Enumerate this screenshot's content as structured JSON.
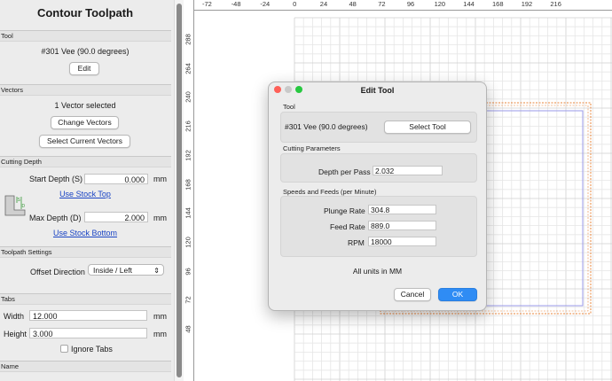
{
  "panel": {
    "title": "Contour Toolpath",
    "tool_section": {
      "header": "Tool",
      "tool_name": "#301 Vee (90.0 degrees)",
      "edit_label": "Edit"
    },
    "vectors_section": {
      "header": "Vectors",
      "status": "1 Vector selected",
      "change_label": "Change Vectors",
      "select_current_label": "Select Current Vectors"
    },
    "depth_section": {
      "header": "Cutting Depth",
      "start_label": "Start Depth (S)",
      "start_value": "0.000",
      "use_stock_top": "Use Stock Top",
      "max_label": "Max Depth (D)",
      "max_value": "2.000",
      "use_stock_bottom": "Use Stock Bottom",
      "unit": "mm",
      "diagram_s": "S",
      "diagram_d": "D"
    },
    "settings_section": {
      "header": "Toolpath Settings",
      "offset_label": "Offset Direction",
      "offset_value": "Inside / Left",
      "offset_icon": "chevron-updown-icon"
    },
    "tabs_section": {
      "header": "Tabs",
      "width_label": "Width",
      "width_value": "12.000",
      "height_label": "Height",
      "height_value": "3.000",
      "unit": "mm",
      "ignore_label": "Ignore Tabs",
      "ignore_checked": false
    },
    "name_section": {
      "header": "Name"
    }
  },
  "canvas": {
    "h_ticks": [
      "-72",
      "-48",
      "-24",
      "0",
      "24",
      "48",
      "72",
      "96",
      "120",
      "144",
      "168",
      "192",
      "216"
    ],
    "v_ticks": [
      "288",
      "264",
      "240",
      "216",
      "192",
      "168",
      "144",
      "120",
      "96",
      "72",
      "48"
    ],
    "colors": {
      "grid_minor": "#e6e6e6",
      "grid_major": "#cfcfcf",
      "stock": "#9a9ae8",
      "toolpath": "#e8843a",
      "cursor_marker": "#e02020"
    }
  },
  "dialog": {
    "title": "Edit Tool",
    "tool_group_label": "Tool",
    "tool_name": "#301 Vee (90.0 degrees)",
    "select_tool_label": "Select Tool",
    "cutting_group_label": "Cutting Parameters",
    "depth_per_pass_label": "Depth per Pass",
    "depth_per_pass_value": "2.032",
    "feeds_group_label": "Speeds and Feeds (per Minute)",
    "plunge_label": "Plunge Rate",
    "plunge_value": "304.8",
    "feed_label": "Feed Rate",
    "feed_value": "889.0",
    "rpm_label": "RPM",
    "rpm_value": "18000",
    "units_note": "All units in MM",
    "cancel_label": "Cancel",
    "ok_label": "OK",
    "traffic_colors": {
      "close": "#fe5f57",
      "minimize": "#c9c9c9",
      "zoom": "#27c840"
    }
  }
}
